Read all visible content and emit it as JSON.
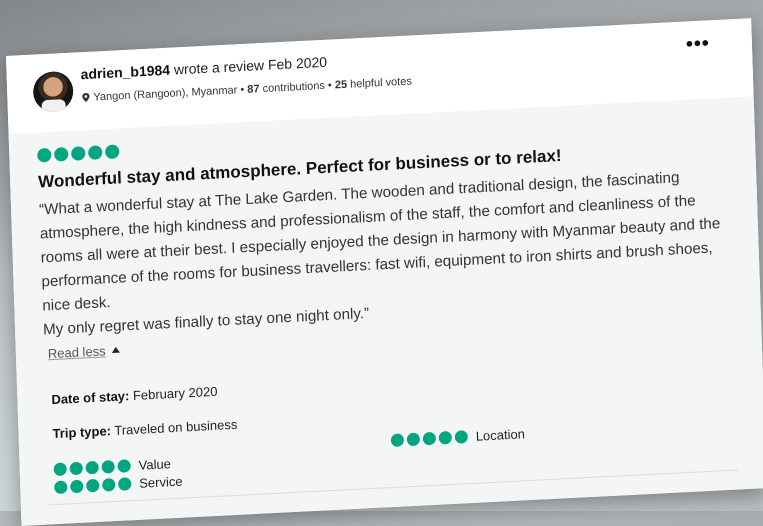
{
  "review": {
    "user": "adrien_b1984",
    "action": "wrote a review Feb 2020",
    "location": "Yangon (Rangoon), Myanmar",
    "contributions": "87",
    "contributions_label": "contributions",
    "helpful_votes": "25",
    "helpful_label": "helpful votes",
    "separator": "•",
    "rating": 5,
    "title": "Wonderful stay and atmosphere. Perfect for business or to relax!",
    "text_paragraph_1": "“What a wonderful stay at The Lake Garden. The wooden and traditional design, the fascinating atmosphere, the high kindness and professionalism of the staff, the comfort and cleanliness of the rooms all were at their best. I especially enjoyed the design in harmony with Myanmar beauty and the performance of the rooms for business travellers: fast wifi, equipment to iron shirts and brush shoes, nice desk.",
    "text_paragraph_2": "My only regret was finally to stay one night only.”",
    "read_less": "Read less",
    "date_of_stay_label": "Date of stay:",
    "date_of_stay_value": "February 2020",
    "trip_type_label": "Trip type:",
    "trip_type_value": "Traveled on business",
    "subratings": [
      {
        "label": "Value",
        "rating": 5
      },
      {
        "label": "Service",
        "rating": 5
      },
      {
        "label": "Location",
        "rating": 5
      }
    ],
    "more_menu": "•••"
  },
  "colors": {
    "bubble": "#00a680",
    "card_body": "#f4f5f5"
  },
  "icons": {
    "pin": "location-pin-icon",
    "more": "more-options-icon",
    "caret": "caret-up-icon"
  }
}
